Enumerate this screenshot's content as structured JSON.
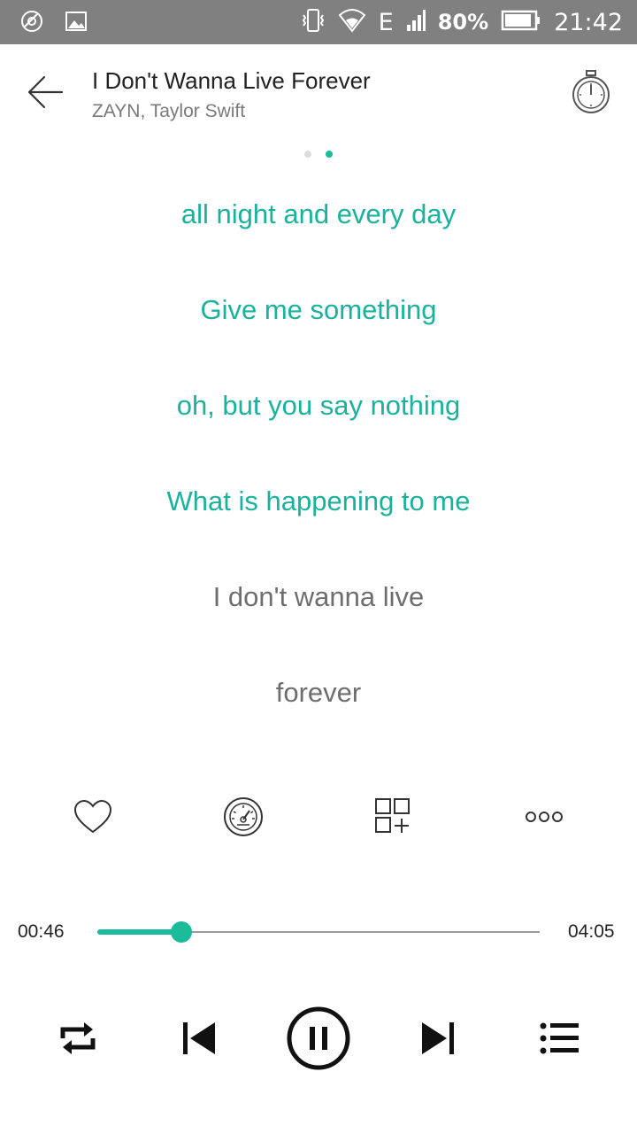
{
  "status_bar": {
    "network": "E",
    "battery": "80%",
    "time": "21:42",
    "icons": [
      "cast-icon",
      "image-icon",
      "vibrate-icon",
      "wifi-icon",
      "signal-icon",
      "battery-icon"
    ]
  },
  "header": {
    "title": "I Don't Wanna Live Forever",
    "artist": "ZAYN, Taylor Swift"
  },
  "pager": {
    "count": 2,
    "active_index": 1
  },
  "lyrics": [
    {
      "text": "all night and every day",
      "state": "played"
    },
    {
      "text": "Give me something",
      "state": "played"
    },
    {
      "text": "oh, but you say nothing",
      "state": "played"
    },
    {
      "text": "What is happening to me",
      "state": "played"
    },
    {
      "text": "I don't wanna live",
      "state": "upcoming"
    },
    {
      "text": "forever",
      "state": "upcoming"
    }
  ],
  "actions": [
    "favorite-heart-icon",
    "sound-effects-dial-icon",
    "add-to-playlist-icon",
    "more-options-icon"
  ],
  "progress": {
    "elapsed": "00:46",
    "total": "04:05",
    "fraction": 0.19
  },
  "controls": [
    "repeat-icon",
    "previous-icon",
    "pause-icon",
    "next-icon",
    "queue-list-icon"
  ],
  "colors": {
    "accent": "#1abc9c",
    "played_lyric": "#1ab29c",
    "upcoming_lyric": "#6e6e6e",
    "status_bar": "#808080"
  }
}
